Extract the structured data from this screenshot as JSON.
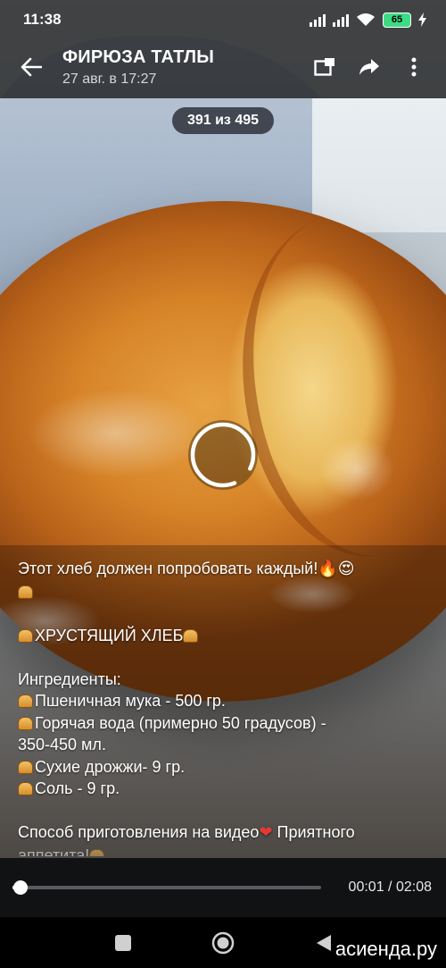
{
  "status_bar": {
    "time": "11:38",
    "battery": "65"
  },
  "header": {
    "title": "ФИРЮЗА ТАТЛЫ",
    "subtitle": "27 авг. в 17:27",
    "icons": [
      "back-arrow-icon",
      "picture-in-picture-icon",
      "share-icon",
      "more-vertical-icon"
    ]
  },
  "media": {
    "counter": "391 из 495"
  },
  "caption": {
    "line1": "Этот хлеб должен попробовать каждый!",
    "line1_emoji": "🔥😍",
    "title": "ХРУСТЯЩИЙ ХЛЕБ",
    "ingredients_heading": "Ингредиенты:",
    "ingredients": [
      "Пшеничная мука - 500 гр.",
      "Горячая вода (примерно 50 градусов) -",
      "350-450 мл.",
      "Сухие дрожжи- 9 гр.",
      "Соль - 9 гр."
    ],
    "method_line": "Способ приготовления на видео",
    "method_emoji": "❤",
    "method_tail": " Приятного",
    "last_line": "аппетита!"
  },
  "player": {
    "current_time": "00:01",
    "separator": "/",
    "duration": "02:08",
    "progress_fraction": 0.008
  },
  "nav": {
    "icons": [
      "recents-square-icon",
      "home-circle-icon",
      "back-triangle-icon"
    ]
  },
  "watermark": "асиенда.ру",
  "colors": {
    "player_bg": "#111214",
    "header_bg": "#0a0a0a",
    "accent": "#ffffff"
  }
}
